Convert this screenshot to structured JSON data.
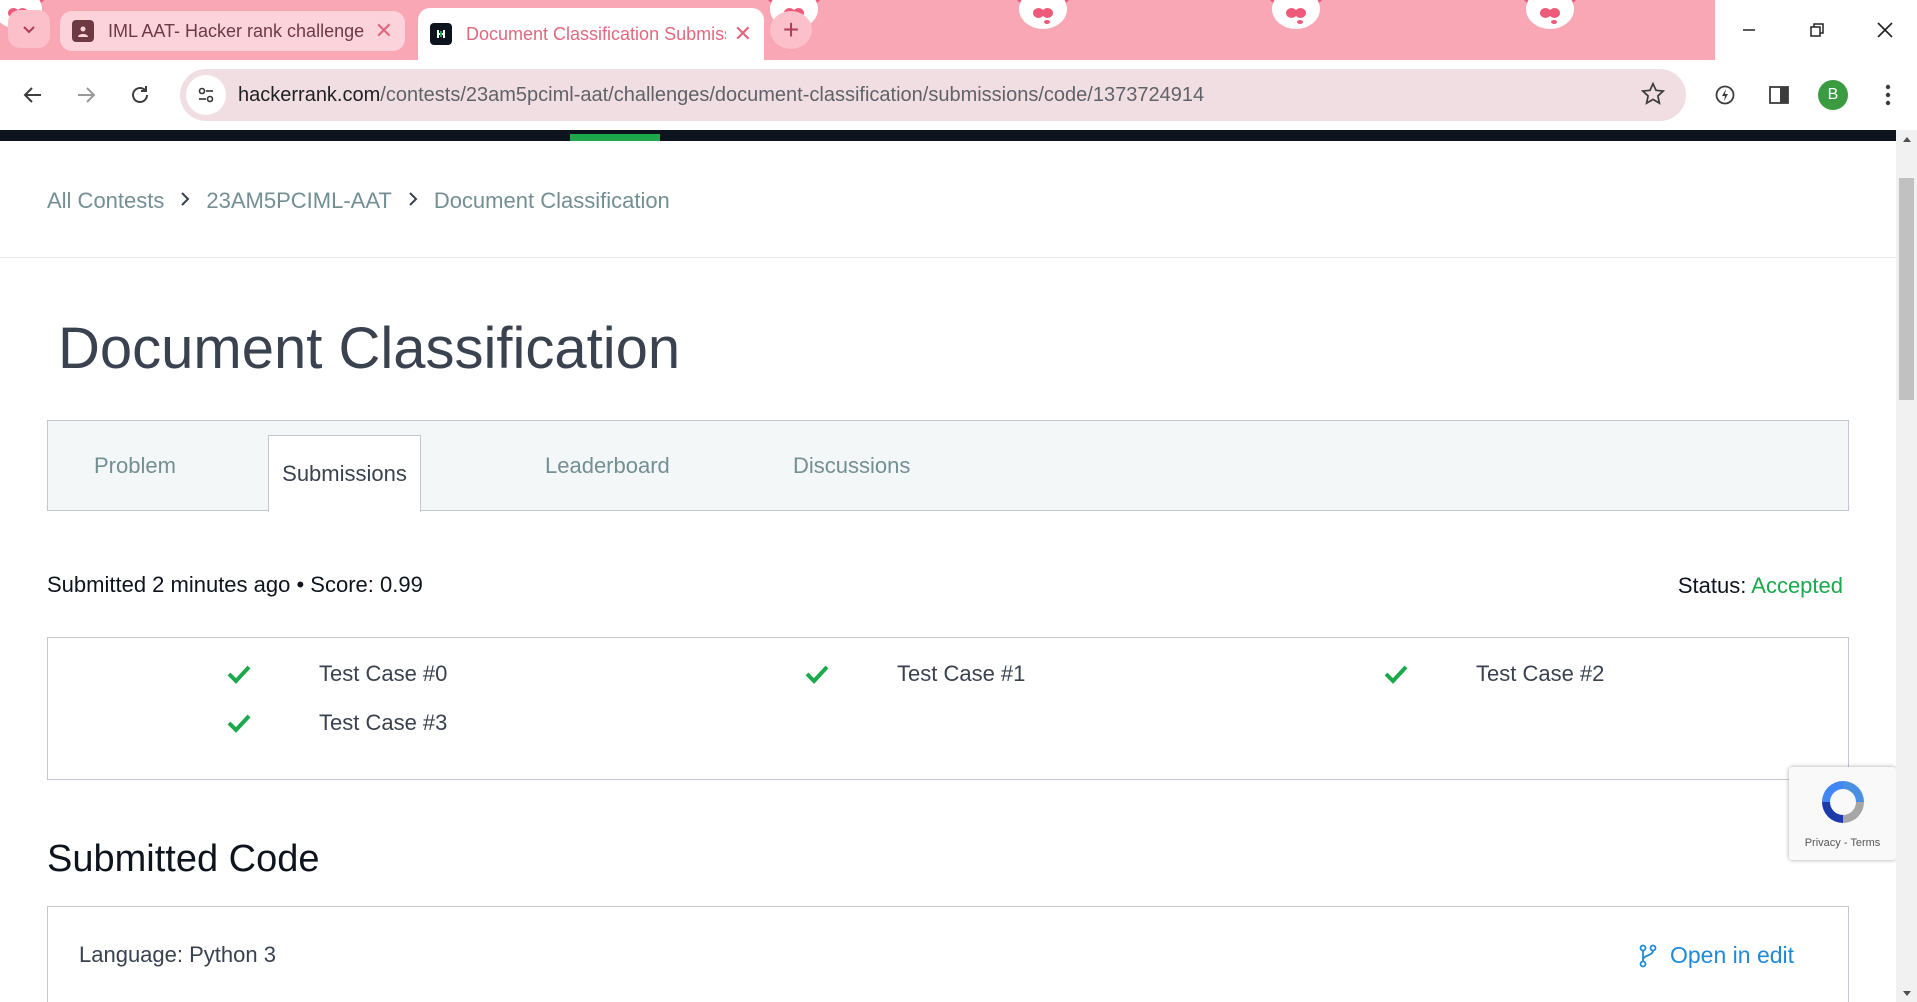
{
  "browser": {
    "tabs": [
      {
        "title": "IML AAT- Hacker rank challenge",
        "favicon": "classroom-icon",
        "active": false
      },
      {
        "title": "Document Classification Submission",
        "favicon": "hackerrank-icon",
        "active": true
      }
    ],
    "address": {
      "host": "hackerrank.com",
      "path": "/contests/23am5pciml-aat/challenges/document-classification/submissions/code/1373724914"
    },
    "profile_initial": "B",
    "theme_color": "#f9a7b4"
  },
  "breadcrumb": [
    "All Contests",
    "23AM5PCIML-AAT",
    "Document Classification"
  ],
  "page_title": "Document Classification",
  "tabs": [
    {
      "label": "Problem",
      "active": false
    },
    {
      "label": "Submissions",
      "active": true
    },
    {
      "label": "Leaderboard",
      "active": false
    },
    {
      "label": "Discussions",
      "active": false
    }
  ],
  "submission": {
    "summary": "Submitted 2 minutes ago • Score: 0.99",
    "status_label": "Status:",
    "status_value": "Accepted",
    "status_color": "#1ba94c"
  },
  "test_cases": [
    {
      "label": "Test Case #0",
      "passed": true
    },
    {
      "label": "Test Case #1",
      "passed": true
    },
    {
      "label": "Test Case #2",
      "passed": true
    },
    {
      "label": "Test Case #3",
      "passed": true
    }
  ],
  "code_section": {
    "title": "Submitted Code",
    "language": "Language: Python 3",
    "open_in_editor": "Open in edit"
  },
  "recaptcha": {
    "text": "Privacy - Terms"
  }
}
